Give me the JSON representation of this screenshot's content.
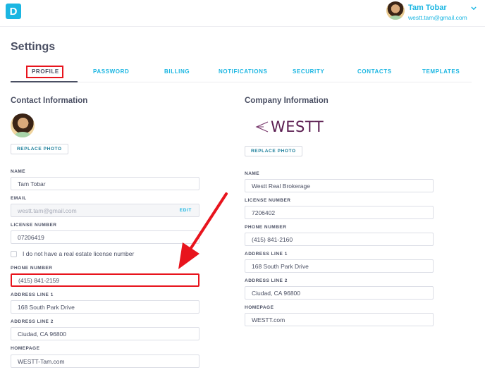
{
  "app": {
    "logo_letter": "D",
    "brand_color": "#1bb6e2",
    "highlight_color": "#e8141d"
  },
  "user": {
    "name": "Tam Tobar",
    "email": "westt.tam@gmail.com",
    "menu_icon": "chevron-down-icon"
  },
  "page": {
    "title": "Settings"
  },
  "tabs": [
    {
      "label": "PROFILE",
      "active": true
    },
    {
      "label": "PASSWORD",
      "active": false
    },
    {
      "label": "BILLING",
      "active": false
    },
    {
      "label": "NOTIFICATIONS",
      "active": false
    },
    {
      "label": "SECURITY",
      "active": false
    },
    {
      "label": "CONTACTS",
      "active": false
    },
    {
      "label": "TEMPLATES",
      "active": false
    }
  ],
  "contact": {
    "title": "Contact Information",
    "replace_photo_label": "REPLACE PHOTO",
    "fields": {
      "name": {
        "label": "NAME",
        "value": "Tam Tobar"
      },
      "email": {
        "label": "EMAIL",
        "value": "westt.tam@gmail.com",
        "edit_label": "EDIT"
      },
      "license": {
        "label": "LICENSE NUMBER",
        "value": "07206419"
      },
      "no_license_checkbox": {
        "label": "I do not have a real estate license number",
        "checked": false
      },
      "phone": {
        "label": "PHONE NUMBER",
        "value": "(415) 841-2159"
      },
      "address1": {
        "label": "ADDRESS LINE 1",
        "value": "168 South Park Drive"
      },
      "address2": {
        "label": "ADDRESS LINE 2",
        "value": "Ciudad, CA 96800"
      },
      "homepage": {
        "label": "HOMEPAGE",
        "value": "WESTT-Tam.com"
      }
    }
  },
  "company": {
    "title": "Company Information",
    "logo_text": "WESTT",
    "replace_photo_label": "REPLACE PHOTO",
    "fields": {
      "name": {
        "label": "NAME",
        "value": "Westt Real Brokerage"
      },
      "license": {
        "label": "LICENSE NUMBER",
        "value": "7206402"
      },
      "phone": {
        "label": "PHONE NUMBER",
        "value": "(415) 841-2160"
      },
      "address1": {
        "label": "ADDRESS LINE 1",
        "value": "168 South Park Drive"
      },
      "address2": {
        "label": "ADDRESS LINE 2",
        "value": "Ciudad, CA 96800"
      },
      "homepage": {
        "label": "HOMEPAGE",
        "value": "WESTT.com"
      }
    }
  }
}
